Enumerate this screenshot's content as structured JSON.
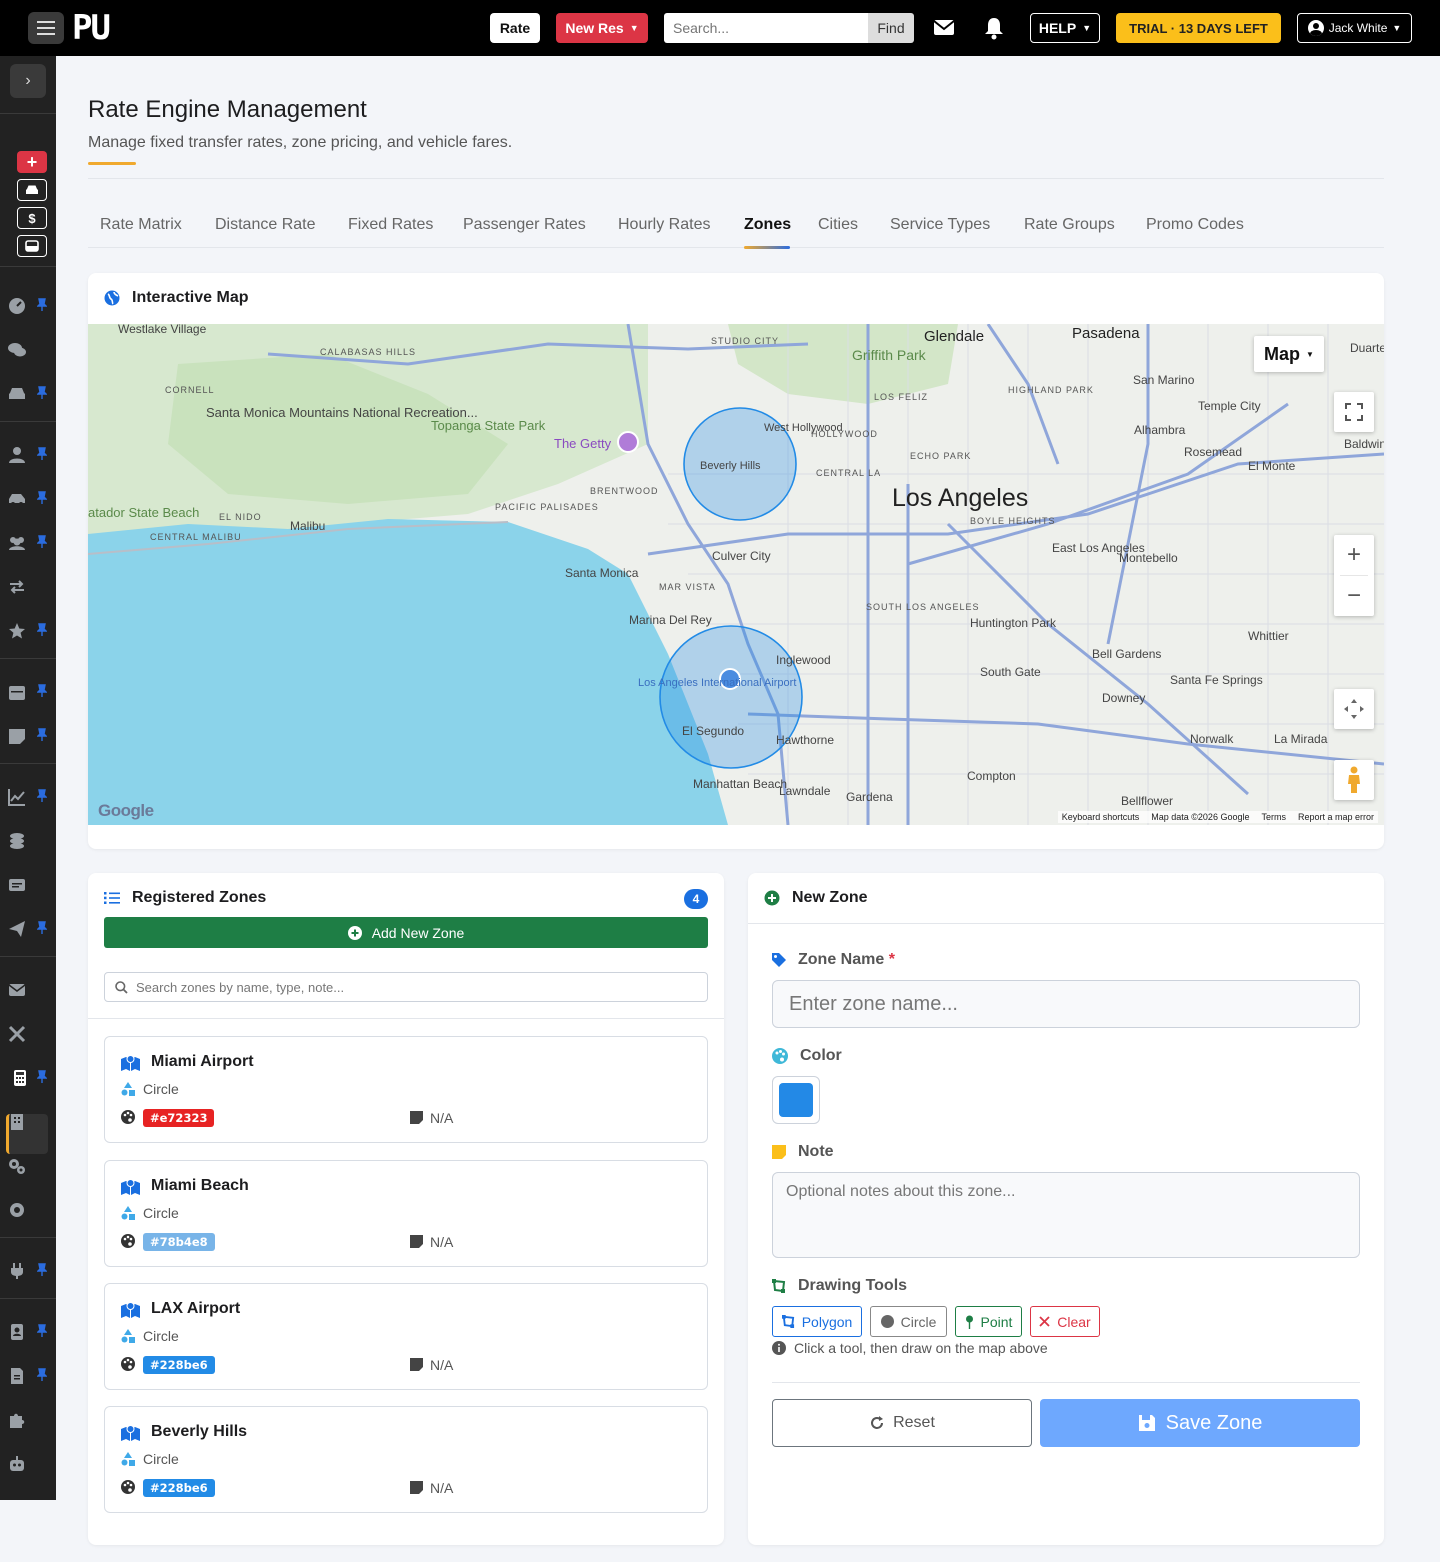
{
  "topbar": {
    "logo": "PU",
    "rate_label": "Rate",
    "new_res_label": "New Res",
    "search_placeholder": "Search...",
    "find_label": "Find",
    "help_label": "HELP",
    "trial_label": "TRIAL · 13 DAYS LEFT",
    "user_name": "Jack White"
  },
  "header": {
    "title": "Rate Engine Management",
    "subtitle": "Manage fixed transfer rates, zone pricing, and vehicle fares."
  },
  "tabs": [
    {
      "label": "Rate Matrix"
    },
    {
      "label": "Distance Rate"
    },
    {
      "label": "Fixed Rates"
    },
    {
      "label": "Passenger Rates"
    },
    {
      "label": "Hourly Rates"
    },
    {
      "label": "Zones",
      "active": true
    },
    {
      "label": "Cities"
    },
    {
      "label": "Service Types"
    },
    {
      "label": "Rate Groups"
    },
    {
      "label": "Promo Codes"
    }
  ],
  "map": {
    "title": "Interactive Map",
    "map_type_label": "Map",
    "brand": "Google",
    "footer": [
      "Keyboard shortcuts",
      "Map data ©2026 Google",
      "Terms",
      "Report a map error"
    ],
    "labels": {
      "los_angeles": "Los Angeles",
      "glendale": "Glendale",
      "pasadena": "Pasadena",
      "santa_monica": "Santa Monica",
      "culver_city": "Culver City",
      "beverly_hills": "Beverly Hills",
      "lax": "Los Angeles International Airport",
      "el_segundo": "El Segundo",
      "inglewood": "Inglewood",
      "hawthorne": "Hawthorne",
      "compton": "Compton",
      "downey": "Downey",
      "whittier": "Whittier",
      "alhambra": "Alhambra",
      "malibu": "Malibu",
      "topanga": "Topanga State Park",
      "getty": "The Getty",
      "south_gate": "South Gate",
      "huntington_park": "Huntington Park",
      "bell_gardens": "Bell Gardens",
      "montebello": "Montebello",
      "east_la": "East Los Angeles",
      "griffith": "Griffith Park",
      "san_marino": "San Marino",
      "temple_city": "Temple City",
      "rosemead": "Rosemead",
      "el_monte": "El Monte",
      "manhattan_beach": "Manhattan Beach",
      "lawndale": "Lawndale",
      "gardena": "Gardena",
      "norwalk": "Norwalk",
      "la_mirada": "La Mirada",
      "bellflower": "Bellflower",
      "santa_fe_springs": "Santa Fe Springs",
      "marina_del_rey": "Marina Del Rey",
      "west_hollywood": "West Hollywood",
      "westlake": "Westlake Village",
      "santa_monica_mtns": "Santa Monica Mountains National Recreation...",
      "zuma": "atador State Beach",
      "duarte": "Duarte",
      "baldwin": "Baldwin",
      "studio_city": "STUDIO CITY",
      "calabasas_hills": "CALABASAS HILLS",
      "cornell": "CORNELL",
      "brentwood": "BRENTWOOD",
      "pacific_palisades": "PACIFIC PALISADES",
      "el_nido": "EL NIDO",
      "central_malibu": "CENTRAL MALIBU",
      "mar_vista": "MAR VISTA",
      "hollywood": "HOLLYWOOD",
      "central_la": "CENTRAL LA",
      "echo_park": "ECHO PARK",
      "los_feliz": "LOS FELIZ",
      "highland_park": "HIGHLAND PARK",
      "boyle_heights": "BOYLE HEIGHTS",
      "south_la": "SOUTH LOS ANGELES"
    }
  },
  "zones": {
    "title": "Registered Zones",
    "count": "4",
    "add_label": "Add New Zone",
    "search_placeholder": "Search zones by name, type, note...",
    "items": [
      {
        "name": "Miami Airport",
        "type": "Circle",
        "color": "#e72323",
        "note": "N/A"
      },
      {
        "name": "Miami Beach",
        "type": "Circle",
        "color": "#78b4e8",
        "note": "N/A"
      },
      {
        "name": "LAX Airport",
        "type": "Circle",
        "color": "#228be6",
        "note": "N/A"
      },
      {
        "name": "Beverly Hills",
        "type": "Circle",
        "color": "#228be6",
        "note": "N/A"
      }
    ]
  },
  "form": {
    "title": "New Zone",
    "zone_name_label": "Zone Name",
    "required_mark": "*",
    "zone_name_placeholder": "Enter zone name...",
    "color_label": "Color",
    "color_value": "#2389e6",
    "note_label": "Note",
    "note_placeholder": "Optional notes about this zone...",
    "drawing_tools_label": "Drawing Tools",
    "tools": {
      "polygon": "Polygon",
      "circle": "Circle",
      "point": "Point",
      "clear": "Clear"
    },
    "hint": "Click a tool, then draw on the map above",
    "reset_label": "Reset",
    "save_label": "Save Zone"
  }
}
